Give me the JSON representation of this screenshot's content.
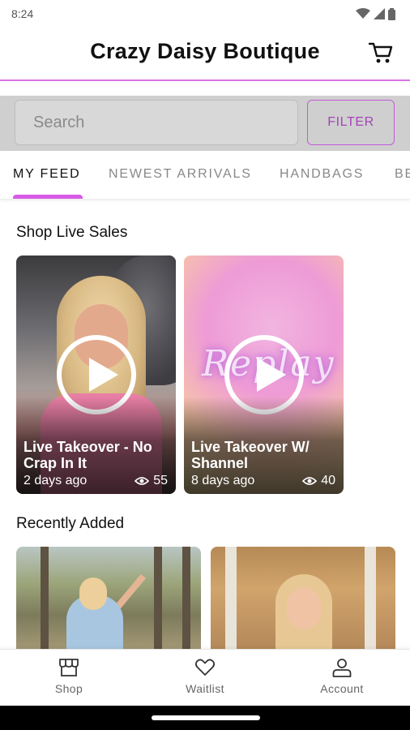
{
  "status_bar": {
    "time": "8:24",
    "icons": [
      "wifi-icon",
      "signal-icon",
      "battery-icon"
    ]
  },
  "header": {
    "title": "Crazy Daisy Boutique",
    "cart_icon": "cart-icon"
  },
  "search": {
    "placeholder": "Search",
    "filter_label": "FILTER"
  },
  "tabs": [
    {
      "label": "MY FEED",
      "active": true
    },
    {
      "label": "NEWEST ARRIVALS",
      "active": false
    },
    {
      "label": "HANDBAGS",
      "active": false
    },
    {
      "label": "BE",
      "active": false
    }
  ],
  "live_sales": {
    "title": "Shop Live Sales",
    "cards": [
      {
        "title": "Live Takeover - No Crap In It",
        "time": "2 days ago",
        "views": "55"
      },
      {
        "title": "Live Takeover W/ Shannel",
        "time": "8 days ago",
        "views": "40",
        "artwork_text": "Replay"
      }
    ]
  },
  "recently_added": {
    "title": "Recently Added"
  },
  "bottom_nav": [
    {
      "label": "Shop",
      "icon": "store-icon"
    },
    {
      "label": "Waitlist",
      "icon": "heart-icon"
    },
    {
      "label": "Account",
      "icon": "person-icon"
    }
  ],
  "colors": {
    "accent": "#d95ae8",
    "filter": "#a443b8",
    "search_bar_bg": "#cfcfcf"
  }
}
